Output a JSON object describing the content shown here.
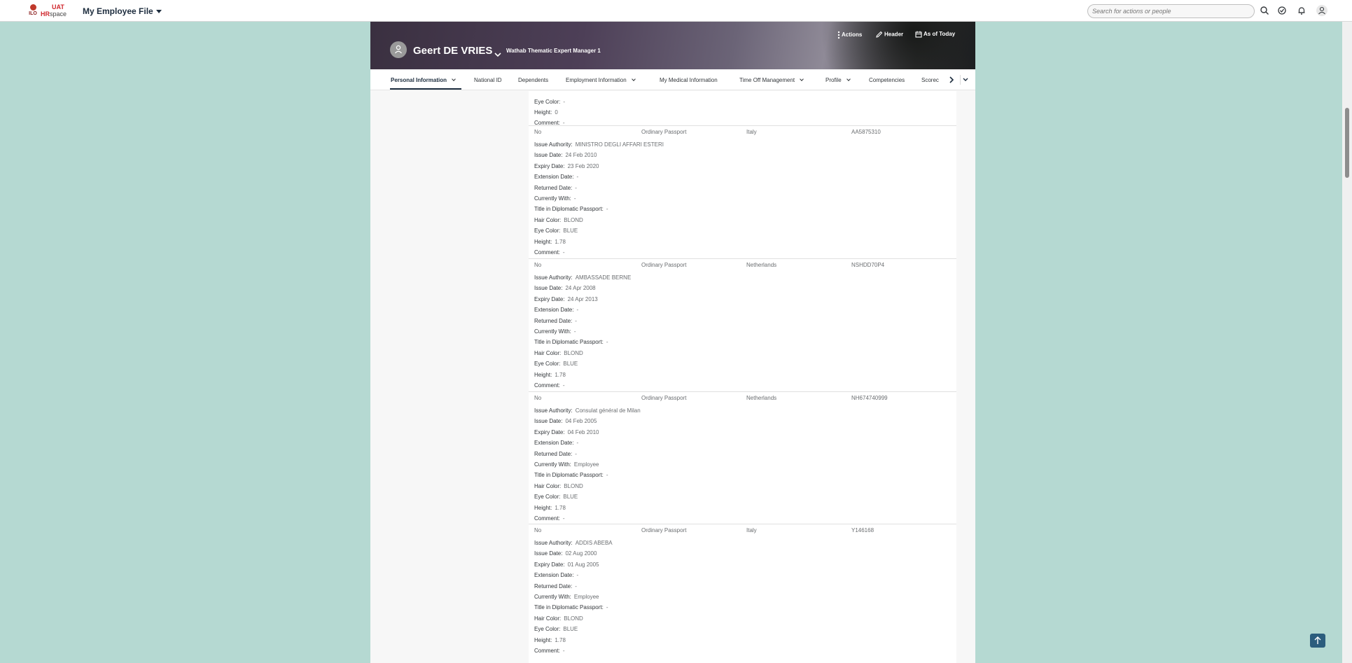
{
  "shell": {
    "logo_ilo": "ILO",
    "logo_uat": "UAT",
    "logo_hr": "HR",
    "logo_space": "space",
    "app_title": "My Employee File",
    "search_placeholder": "Search for actions or people"
  },
  "header": {
    "employee_name": "Geert DE VRIES",
    "employee_title": "Wathab Thematic Expert Manager 1",
    "actions_label": "Actions",
    "header_label": "Header",
    "as_of_label": "As of Today"
  },
  "tabs": [
    {
      "label": "Personal Information",
      "active": true,
      "dropdown": true
    },
    {
      "label": "National ID",
      "active": false,
      "dropdown": false
    },
    {
      "label": "Dependents",
      "active": false,
      "dropdown": false
    },
    {
      "label": "Employment Information",
      "active": false,
      "dropdown": true
    },
    {
      "label": "My Medical Information",
      "active": false,
      "dropdown": false
    },
    {
      "label": "Time Off Management",
      "active": false,
      "dropdown": true
    },
    {
      "label": "Profile",
      "active": false,
      "dropdown": true
    },
    {
      "label": "Competencies",
      "active": false,
      "dropdown": false
    },
    {
      "label": "Scorec",
      "active": false,
      "dropdown": false
    }
  ],
  "partial_record": {
    "eye_color_label": "Eye Color:",
    "eye_color": "-",
    "height_label": "Height:",
    "height": "0",
    "comment_label": "Comment:",
    "comment": "-"
  },
  "labels": {
    "issue_authority": "Issue Authority:",
    "issue_date": "Issue Date:",
    "expiry_date": "Expiry Date:",
    "extension_date": "Extension Date:",
    "returned_date": "Returned Date:",
    "currently_with": "Currently With:",
    "title_diplomatic": "Title in Diplomatic Passport:",
    "hair_color": "Hair Color:",
    "eye_color": "Eye Color:",
    "height": "Height:",
    "comment": "Comment:"
  },
  "passports": [
    {
      "primary": "No",
      "type": "Ordinary Passport",
      "country": "Italy",
      "number": "AA5875310",
      "issue_authority": "MINISTRO DEGLI AFFARI ESTERI",
      "issue_date": "24 Feb 2010",
      "expiry_date": "23 Feb 2020",
      "extension_date": "-",
      "returned_date": "-",
      "currently_with": "-",
      "title_diplomatic": "-",
      "hair_color": "BLOND",
      "eye_color": "BLUE",
      "height": "1.78",
      "comment": "-"
    },
    {
      "primary": "No",
      "type": "Ordinary Passport",
      "country": "Netherlands",
      "number": "NSHDD70P4",
      "issue_authority": "AMBASSADE BERNE",
      "issue_date": "24 Apr 2008",
      "expiry_date": "24 Apr 2013",
      "extension_date": "-",
      "returned_date": "-",
      "currently_with": "-",
      "title_diplomatic": "-",
      "hair_color": "BLOND",
      "eye_color": "BLUE",
      "height": "1.78",
      "comment": "-"
    },
    {
      "primary": "No",
      "type": "Ordinary Passport",
      "country": "Netherlands",
      "number": "NH674740999",
      "issue_authority": "Consulat général de Milan",
      "issue_date": "04 Feb 2005",
      "expiry_date": "04 Feb 2010",
      "extension_date": "-",
      "returned_date": "-",
      "currently_with": "Employee",
      "title_diplomatic": "-",
      "hair_color": "BLOND",
      "eye_color": "BLUE",
      "height": "1.78",
      "comment": "-"
    },
    {
      "primary": "No",
      "type": "Ordinary Passport",
      "country": "Italy",
      "number": "Y146168",
      "issue_authority": "ADDIS ABEBA",
      "issue_date": "02 Aug 2000",
      "expiry_date": "01 Aug 2005",
      "extension_date": "-",
      "returned_date": "-",
      "currently_with": "Employee",
      "title_diplomatic": "-",
      "hair_color": "BLOND",
      "eye_color": "BLUE",
      "height": "1.78",
      "comment": "-"
    }
  ]
}
